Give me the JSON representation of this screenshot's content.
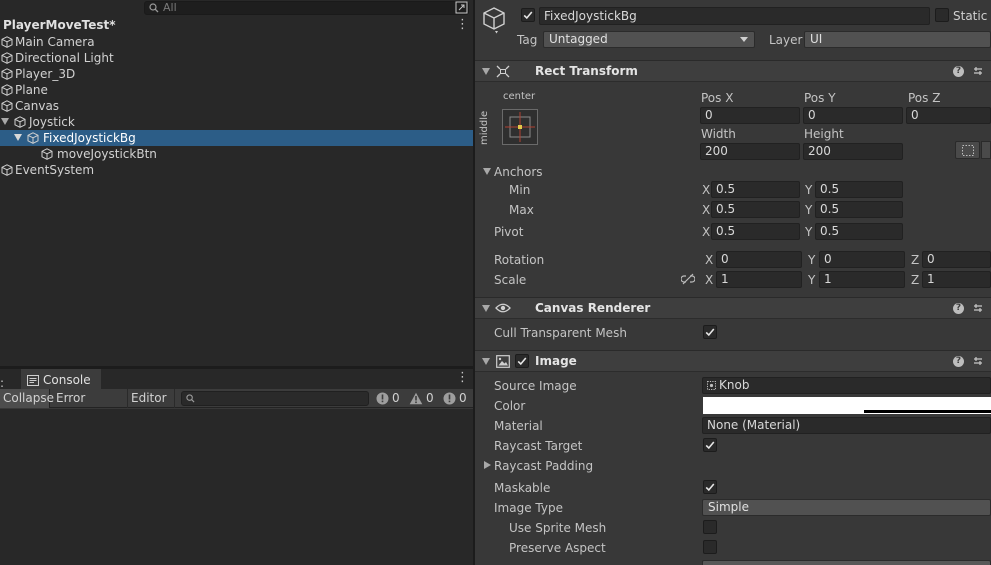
{
  "hierarchy": {
    "search_placeholder": "All",
    "scene_name": "PlayerMoveTest*",
    "menu_glyph": "⋮",
    "items": [
      {
        "label": "Main Camera"
      },
      {
        "label": "Directional Light"
      },
      {
        "label": "Player_3D"
      },
      {
        "label": "Plane"
      },
      {
        "label": "Canvas"
      },
      {
        "label": "Joystick"
      },
      {
        "label": "FixedJoystickBg"
      },
      {
        "label": "moveJoystickBtn"
      },
      {
        "label": "EventSystem"
      }
    ]
  },
  "console": {
    "tab_label": "Console",
    "collapse_label": "Collapse",
    "error_pause_label": "Error Pause",
    "editor_label": "Editor",
    "log_count": "0",
    "warning_count": "0",
    "error_count": "0",
    "menu_glyph": "⋮"
  },
  "inspector": {
    "object_name": "FixedJoystickBg",
    "static_label": "Static",
    "tag_label": "Tag",
    "tag_value": "Untagged",
    "layer_label": "Layer",
    "layer_value": "UI",
    "rect_transform": {
      "title": "Rect Transform",
      "anchor_h": "center",
      "anchor_v": "middle",
      "pos_x_label": "Pos X",
      "pos_y_label": "Pos Y",
      "pos_z_label": "Pos Z",
      "pos_x": "0",
      "pos_y": "0",
      "pos_z": "0",
      "width_label": "Width",
      "height_label": "Height",
      "width": "200",
      "height": "200",
      "anchors_label": "Anchors",
      "min_label": "Min",
      "max_label": "Max",
      "min_x": "0.5",
      "min_y": "0.5",
      "max_x": "0.5",
      "max_y": "0.5",
      "pivot_label": "Pivot",
      "pivot_x": "0.5",
      "pivot_y": "0.5",
      "rotation_label": "Rotation",
      "rot_x": "0",
      "rot_y": "0",
      "rot_z": "0",
      "scale_label": "Scale",
      "scale_x": "1",
      "scale_y": "1",
      "scale_z": "1",
      "x": "X",
      "y": "Y",
      "z": "Z"
    },
    "canvas_renderer": {
      "title": "Canvas Renderer",
      "cull_label": "Cull Transparent Mesh"
    },
    "image": {
      "title": "Image",
      "source_label": "Source Image",
      "source_value": "Knob",
      "color_label": "Color",
      "material_label": "Material",
      "material_value": "None (Material)",
      "raycast_target_label": "Raycast Target",
      "raycast_padding_label": "Raycast Padding",
      "maskable_label": "Maskable",
      "image_type_label": "Image Type",
      "image_type_value": "Simple",
      "use_sprite_mesh_label": "Use Sprite Mesh",
      "preserve_aspect_label": "Preserve Aspect"
    }
  },
  "colors": {
    "selection": "#2c5d87",
    "panel": "#383838",
    "hierarchy_bg": "#282828",
    "field": "#2a2a2a"
  }
}
